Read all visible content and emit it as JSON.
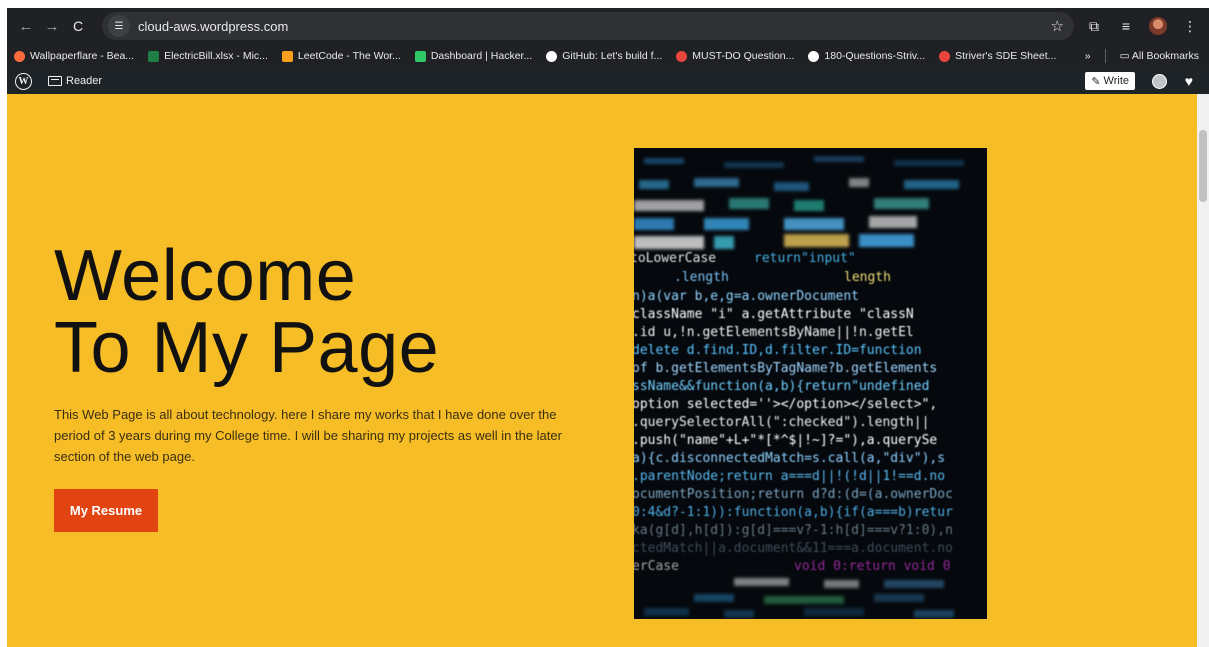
{
  "browser": {
    "url": "cloud-aws.wordpress.com",
    "nav": {
      "back": "←",
      "forward": "→",
      "reload": "C"
    },
    "bookmarks": [
      {
        "label": "Wallpaperflare - Bea...",
        "color": "#ff6b3d"
      },
      {
        "label": "ElectricBill.xlsx - Mic...",
        "color": "#1e7e45"
      },
      {
        "label": "LeetCode - The Wor...",
        "color": "#f89f1b"
      },
      {
        "label": "Dashboard | Hacker...",
        "color": "#2ec866"
      },
      {
        "label": "GitHub: Let's build f...",
        "color": "#ffffff"
      },
      {
        "label": "MUST-DO Question...",
        "color": "#e8453c"
      },
      {
        "label": "180-Questions-Striv...",
        "color": "#ffffff"
      },
      {
        "label": "Striver's SDE Sheet...",
        "color": "#e8453c"
      }
    ],
    "more": "»",
    "all_bookmarks": "All Bookmarks"
  },
  "wp_admin": {
    "logo": "W",
    "reader_label": "Reader",
    "write_label": "Write"
  },
  "hero": {
    "heading_line1": "Welcome",
    "heading_line2": "To My Page",
    "description": "This Web Page is all about technology. here I share my works that I have done over the period of 3 years during my College time. I will be sharing my projects as well in the later section of the web page.",
    "button_label": "My Resume",
    "accent_color": "#f7bd27",
    "button_color": "#e24411"
  }
}
